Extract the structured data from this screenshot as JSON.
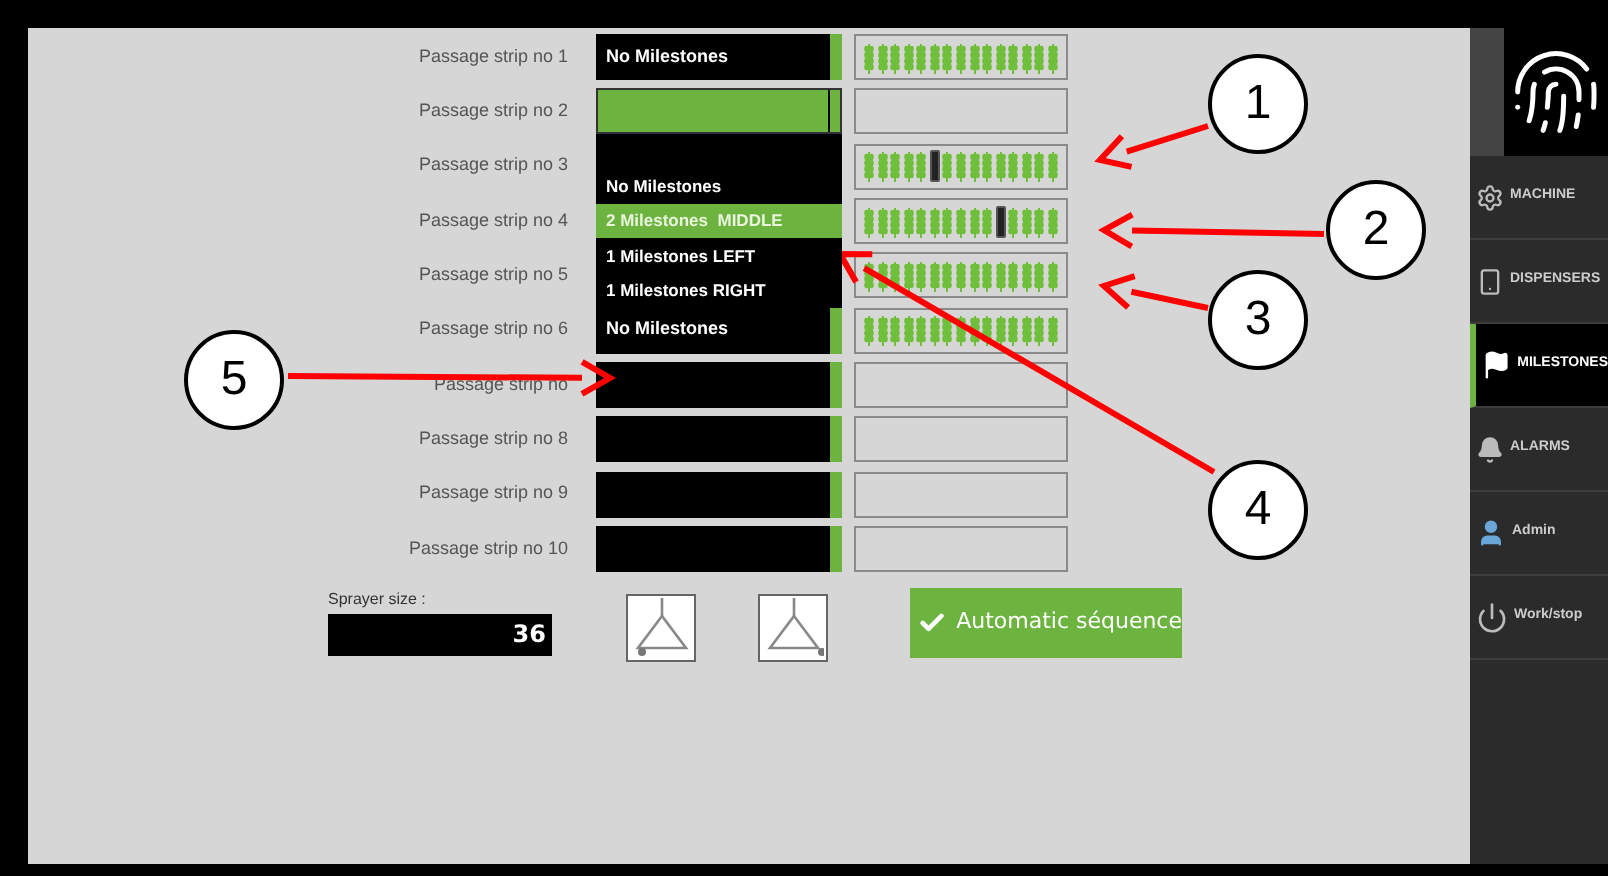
{
  "rows": [
    {
      "label": "Passage strip no 1",
      "value": "No Milestones",
      "open": false,
      "strip": {
        "kind": "plants"
      }
    },
    {
      "label": "Passage strip no 2",
      "open": true,
      "strip": {
        "kind": "empty"
      }
    },
    {
      "label": "Passage strip no 3",
      "open": false,
      "strip": {
        "kind": "marker_left"
      }
    },
    {
      "label": "Passage strip no 4",
      "open": false,
      "strip": {
        "kind": "marker_right"
      }
    },
    {
      "label": "Passage strip no 5",
      "open": false,
      "strip": {
        "kind": "plants"
      }
    },
    {
      "label": "Passage strip no 6",
      "value": "No Milestones",
      "open": false,
      "strip": {
        "kind": "plants"
      }
    },
    {
      "label": "Passage strip no",
      "open": false,
      "strip": {
        "kind": "empty"
      }
    },
    {
      "label": "Passage strip no 8",
      "open": false,
      "strip": {
        "kind": "empty"
      }
    },
    {
      "label": "Passage strip no 9",
      "open": false,
      "strip": {
        "kind": "empty"
      }
    },
    {
      "label": "Passage strip no 10",
      "open": false,
      "strip": {
        "kind": "empty"
      }
    }
  ],
  "dropdown": {
    "options": [
      {
        "label": "No Milestones",
        "selected": false
      },
      {
        "label": "2 Milestones  MIDDLE",
        "selected": true
      },
      {
        "label": "1 Milestones LEFT",
        "selected": false
      },
      {
        "label": "1 Milestones RIGHT",
        "selected": false
      }
    ]
  },
  "sprayer": {
    "label": "Sprayer size :",
    "value": "36"
  },
  "boom_buttons": [
    {
      "kind": "left"
    },
    {
      "kind": "right"
    }
  ],
  "auto_button": {
    "label": "Automatic séquence"
  },
  "sidebar": {
    "items": [
      {
        "label": "MACHINE",
        "kind": "gear",
        "selected": false
      },
      {
        "label": "DISPENSERS",
        "kind": "device",
        "selected": false
      },
      {
        "label": "MILESTONES",
        "kind": "flag",
        "selected": true
      },
      {
        "label": "ALARMS",
        "kind": "bell",
        "selected": false
      },
      {
        "label": "Admin",
        "kind": "user",
        "selected": false
      },
      {
        "label": "Work/stop",
        "kind": "power",
        "selected": false
      }
    ]
  },
  "callouts": [
    {
      "label": "1"
    },
    {
      "label": "2"
    },
    {
      "label": "3"
    },
    {
      "label": "4"
    },
    {
      "label": "5"
    }
  ]
}
